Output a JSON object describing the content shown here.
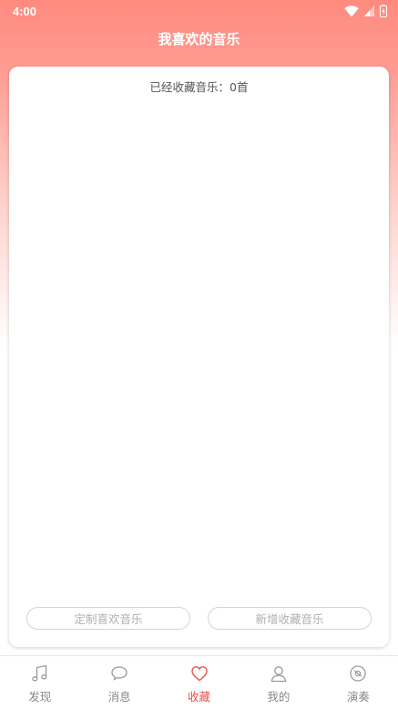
{
  "status_bar": {
    "time": "4:00",
    "icons": [
      "wifi-icon",
      "signal-icon",
      "battery-icon"
    ]
  },
  "header": {
    "title": "我喜欢的音乐"
  },
  "content": {
    "count_text": "已经收藏音乐：0首",
    "buttons": {
      "customize_label": "定制喜欢音乐",
      "add_label": "新增收藏音乐"
    }
  },
  "tab_bar": {
    "active_index": 2,
    "items": [
      {
        "label": "发现",
        "icon": "music-note-icon"
      },
      {
        "label": "消息",
        "icon": "chat-bubble-icon"
      },
      {
        "label": "收藏",
        "icon": "heart-icon"
      },
      {
        "label": "我的",
        "icon": "user-icon"
      },
      {
        "label": "演奏",
        "icon": "disc-icon"
      }
    ]
  },
  "colors": {
    "header_gradient_top": "#ff8a7e",
    "accent": "#e8534a",
    "inactive_tab": "#8a8a8a"
  }
}
